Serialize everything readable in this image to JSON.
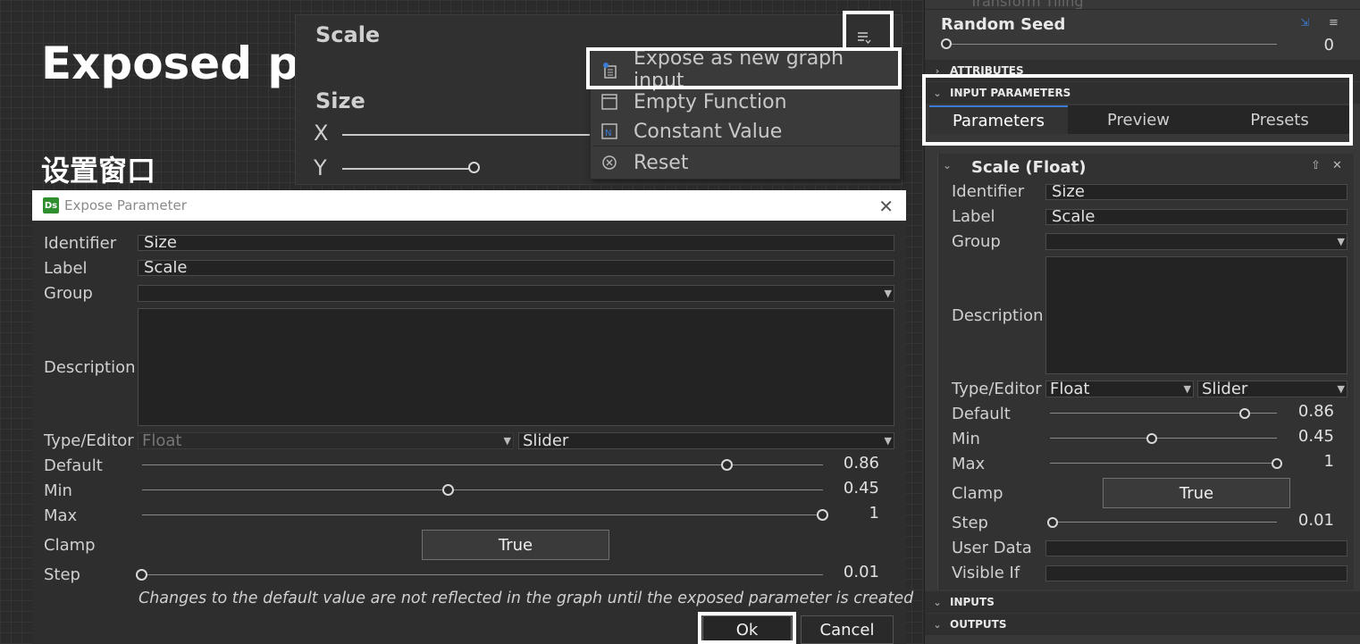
{
  "annotations": {
    "exposed_parameter": "Exposed parameter",
    "settings_window": "设置窗口"
  },
  "node": {
    "scale_title": "Scale",
    "size_title": "Size",
    "x_label": "X",
    "y_label": "Y"
  },
  "context_menu": {
    "items": [
      {
        "label": "Expose as new graph input",
        "icon": "expose-icon"
      },
      {
        "label": "Empty Function",
        "icon": "function-icon"
      },
      {
        "label": "Constant Value",
        "icon": "constant-icon"
      },
      {
        "label": "Reset",
        "icon": "reset-icon"
      }
    ]
  },
  "dialog": {
    "title": "Expose Parameter",
    "app_badge": "Ds",
    "labels": {
      "identifier": "Identifier",
      "label": "Label",
      "group": "Group",
      "description": "Description",
      "type_editor": "Type/Editor",
      "default": "Default",
      "min": "Min",
      "max": "Max",
      "clamp": "Clamp",
      "step": "Step"
    },
    "identifier_value": "Size",
    "label_value": "Scale",
    "group_value": "",
    "type_value": "Float",
    "editor_value": "Slider",
    "default_value": "0.86",
    "min_value": "0.45",
    "max_value": "1",
    "clamp_value": "True",
    "step_value": "0.01",
    "sliders": {
      "default": 0.86,
      "min": 0.45,
      "max": 1.0,
      "step": 0.0
    },
    "note": "Changes to the default value are not reflected in the graph until the exposed parameter is created",
    "ok": "Ok",
    "cancel": "Cancel"
  },
  "panel": {
    "top_partial": "Transform Tiling",
    "random_seed_label": "Random Seed",
    "random_seed_value": "0",
    "sections": {
      "attributes": "ATTRIBUTES",
      "input_parameters": "INPUT PARAMETERS",
      "inputs": "INPUTS",
      "outputs": "OUTPUTS"
    },
    "tabs": [
      "Parameters",
      "Preview",
      "Presets"
    ],
    "param_title": "Scale (Float)",
    "labels": {
      "identifier": "Identifier",
      "label": "Label",
      "group": "Group",
      "description": "Description",
      "type_editor": "Type/Editor",
      "default": "Default",
      "min": "Min",
      "max": "Max",
      "clamp": "Clamp",
      "step": "Step",
      "user_data": "User Data",
      "visible_if": "Visible If"
    },
    "identifier_value": "Size",
    "label_value": "Scale",
    "type_value": "Float",
    "editor_value": "Slider",
    "default_value": "0.86",
    "min_value": "0.45",
    "max_value": "1",
    "clamp_value": "True",
    "step_value": "0.01"
  },
  "colors": {
    "highlight": "#ffffff",
    "tab_accent": "#3a7bd5"
  }
}
